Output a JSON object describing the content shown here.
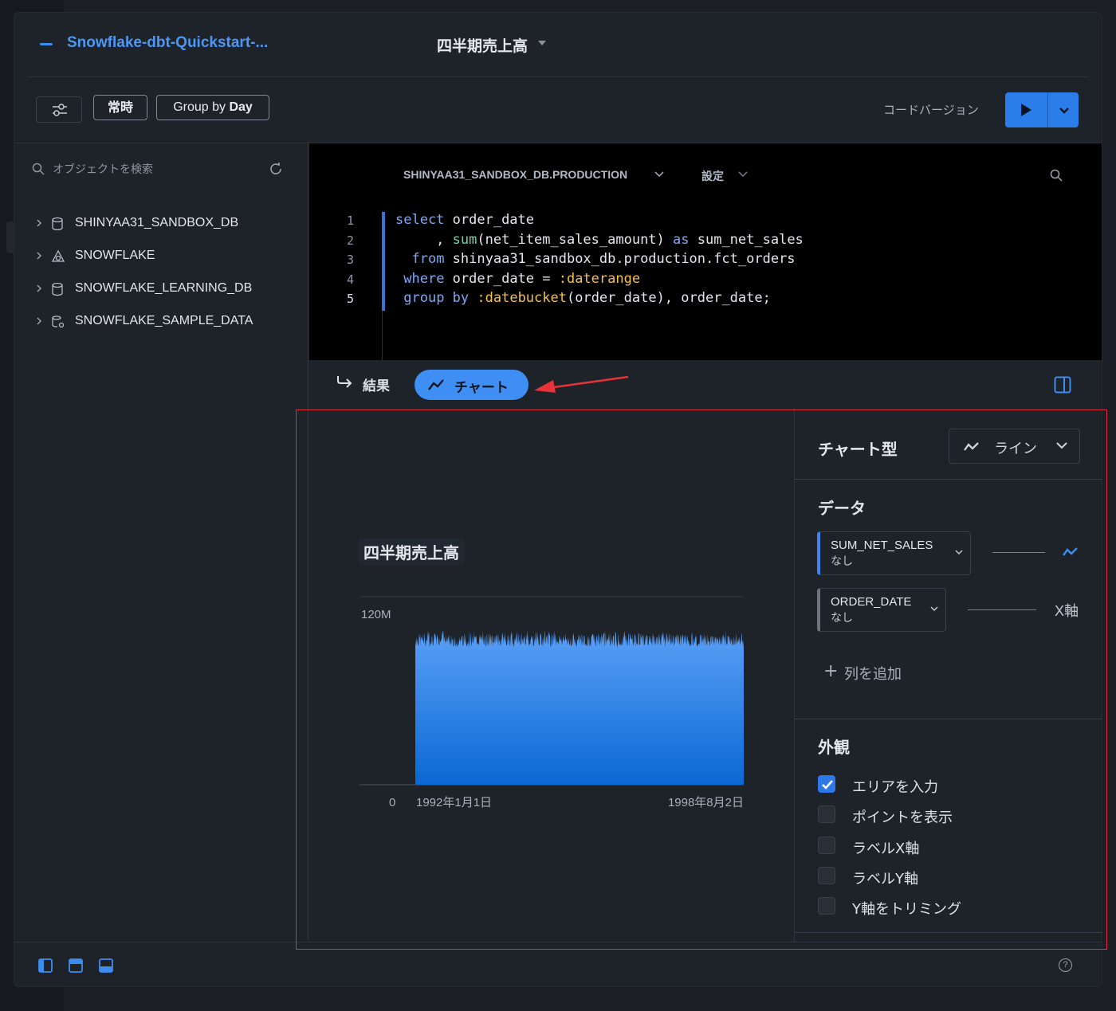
{
  "header": {
    "project_name": "Snowflake-dbt-Quickstart-...",
    "worksheet_title": "四半期売上高"
  },
  "toolbar": {
    "filter_icon": "sliders-icon",
    "always_label": "常時",
    "group_by_prefix": "Group by",
    "group_by_value": "Day",
    "code_version_label": "コードバージョン",
    "run_icon": "play-icon"
  },
  "sidebar": {
    "search_placeholder": "オブジェクトを検索",
    "items": [
      {
        "label": "SHINYAA31_SANDBOX_DB",
        "icon": "database-icon"
      },
      {
        "label": "SNOWFLAKE",
        "icon": "snowflake-share-icon"
      },
      {
        "label": "SNOWFLAKE_LEARNING_DB",
        "icon": "database-icon"
      },
      {
        "label": "SNOWFLAKE_SAMPLE_DATA",
        "icon": "shared-database-icon"
      }
    ]
  },
  "editor": {
    "context": "SHINYAA31_SANDBOX_DB.PRODUCTION",
    "settings_label": "設定",
    "line_numbers": [
      "1",
      "2",
      "3",
      "4",
      "5"
    ],
    "code_lines": [
      "select order_date",
      "     , sum(net_item_sales_amount) as sum_net_sales",
      "  from shinyaa31_sandbox_db.production.fct_orders",
      " where order_date = :daterange",
      " group by :datebucket(order_date), order_date;"
    ]
  },
  "tabs": {
    "results_label": "結果",
    "chart_label": "チャート"
  },
  "chart_panel": {
    "chart_type_heading": "チャート型",
    "chart_type_value": "ライン",
    "data_heading": "データ",
    "fields": [
      {
        "name": "SUM_NET_SALES",
        "agg": "なし",
        "role_icon": "line-chart-icon"
      },
      {
        "name": "ORDER_DATE",
        "agg": "なし",
        "role": "X軸"
      }
    ],
    "add_column_label": "列を追加",
    "appearance_heading": "外観",
    "options": [
      {
        "label": "エリアを入力",
        "checked": true
      },
      {
        "label": "ポイントを表示",
        "checked": false
      },
      {
        "label": "ラベルX軸",
        "checked": false
      },
      {
        "label": "ラベルY軸",
        "checked": false
      },
      {
        "label": "Y軸をトリミング",
        "checked": false
      }
    ]
  },
  "chart_data": {
    "type": "area",
    "title": "四半期売上高",
    "x_start": "1992年1月1日",
    "x_end": "1998年8月2日",
    "y_ticks": [
      "0",
      "120M"
    ],
    "ylim": [
      0,
      140000000
    ],
    "series": [
      {
        "approx_daily_min": 102000000,
        "approx_daily_max": 115000000,
        "typical": 108000000
      }
    ],
    "fill_colors": [
      "#5aa0f7",
      "#0a68d4"
    ]
  }
}
